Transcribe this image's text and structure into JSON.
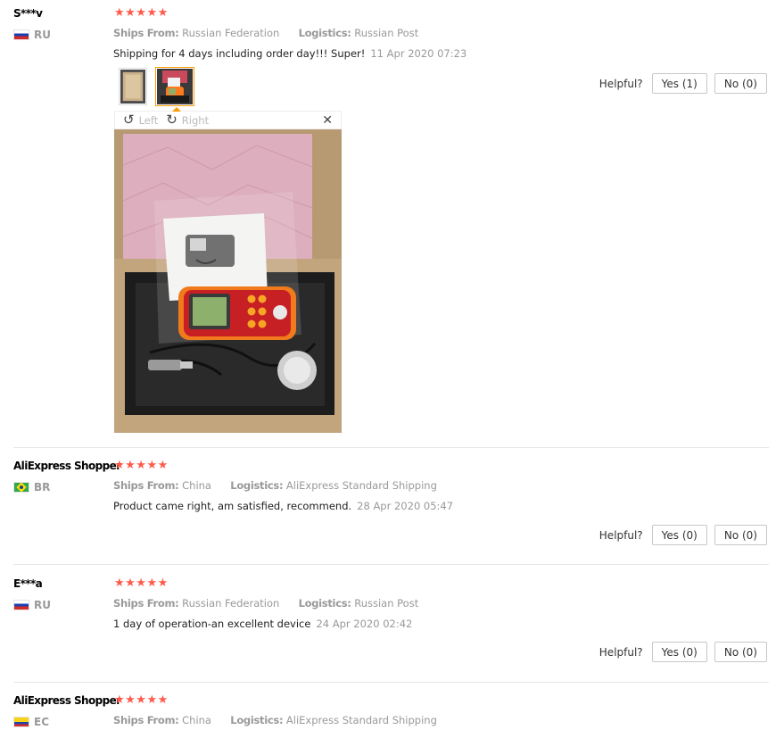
{
  "labels": {
    "ships_from": "Ships From:",
    "logistics": "Logistics:",
    "helpful": "Helpful?",
    "rotate_left": "Left",
    "rotate_right": "Right",
    "rotate_left_icon": "↺",
    "rotate_right_icon": "↻",
    "close_icon": "✕"
  },
  "colors": {
    "star": "#ff5a4a",
    "active_thumb_border": "#ff9c00",
    "muted_text": "#999999"
  },
  "reviews": [
    {
      "name": "S***v",
      "country": "RU",
      "flag": "russia-flag",
      "stars": "★★★★★",
      "ships_from": "Russian Federation",
      "logistics": "Russian Post",
      "text": "Shipping for 4 days including order day!!! Super!",
      "date": "11 Apr 2020 07:23",
      "yes": "Yes (1)",
      "no": "No (0)",
      "photos": [
        "photo-thumbnail-1",
        "photo-thumbnail-2"
      ]
    },
    {
      "name": "AliExpress Shopper",
      "country": "BR",
      "flag": "brazil-flag",
      "stars": "★★★★★",
      "ships_from": "China",
      "logistics": "AliExpress Standard Shipping",
      "text": "Product came right, am satisfied, recommend.",
      "date": "28 Apr 2020 05:47",
      "yes": "Yes (0)",
      "no": "No (0)"
    },
    {
      "name": "E***a",
      "country": "RU",
      "flag": "russia-flag",
      "stars": "★★★★★",
      "ships_from": "Russian Federation",
      "logistics": "Russian Post",
      "text": "1 day of operation-an excellent device",
      "date": "24 Apr 2020 02:42",
      "yes": "Yes (0)",
      "no": "No (0)"
    },
    {
      "name": "AliExpress Shopper",
      "country": "EC",
      "flag": "ecuador-flag",
      "stars": "★★★★★",
      "ships_from": "China",
      "logistics": "AliExpress Standard Shipping"
    }
  ]
}
